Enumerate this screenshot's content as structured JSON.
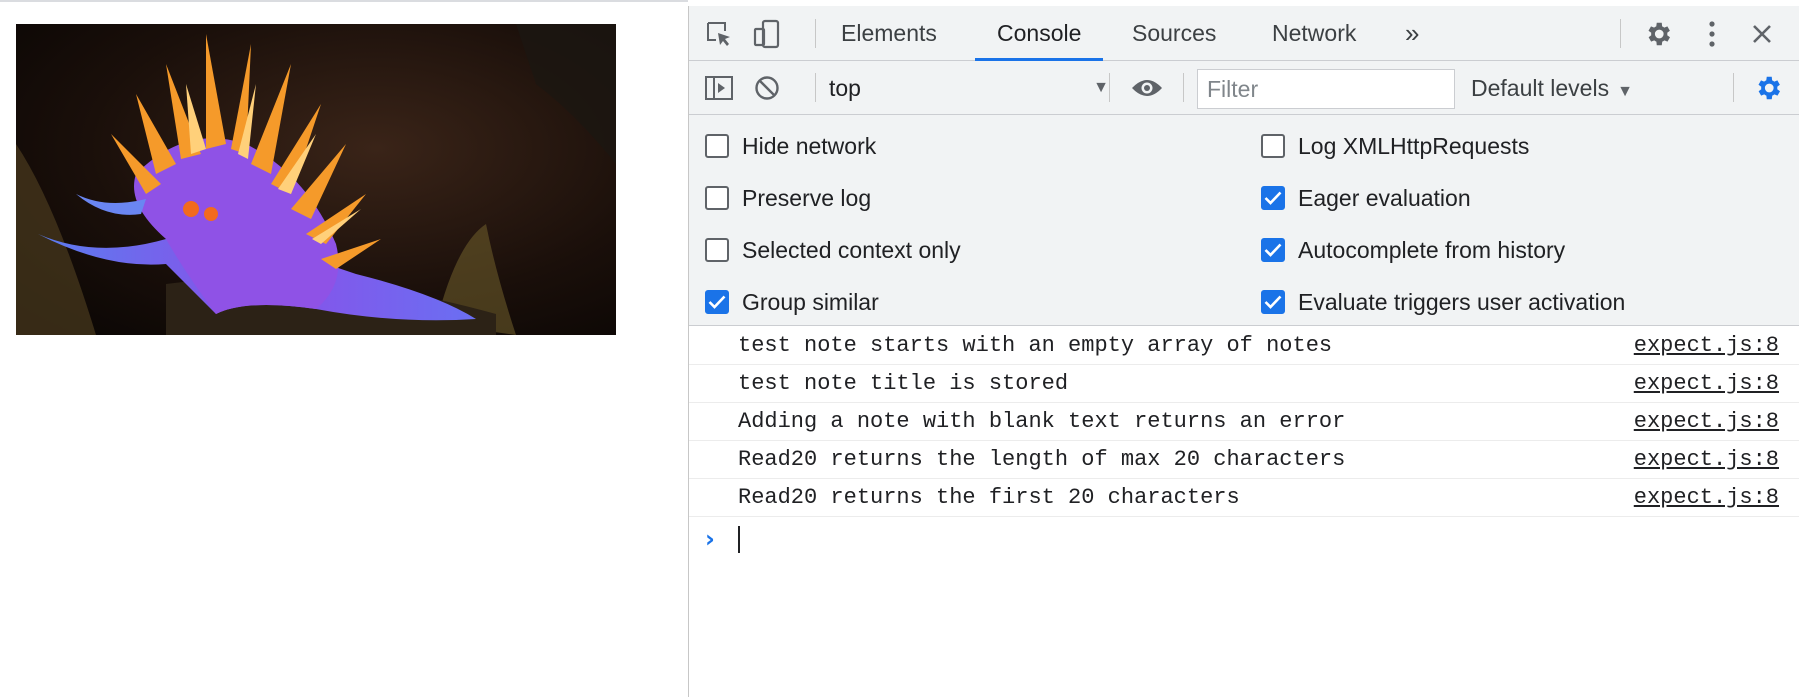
{
  "devtools": {
    "tabs": {
      "elements": "Elements",
      "console": "Console",
      "sources": "Sources",
      "network": "Network",
      "more": "»"
    },
    "toolbar": {
      "context": "top",
      "filter_placeholder": "Filter",
      "levels": "Default levels"
    },
    "settings": {
      "hide_network": "Hide network",
      "preserve_log": "Preserve log",
      "selected_context": "Selected context only",
      "group_similar": "Group similar",
      "log_xhr": "Log XMLHttpRequests",
      "eager_eval": "Eager evaluation",
      "autocomplete": "Autocomplete from history",
      "eval_triggers": "Evaluate triggers user activation"
    },
    "messages": [
      {
        "text": "test note starts with an empty array of notes",
        "source": "expect.js:8"
      },
      {
        "text": "test note title is stored",
        "source": "expect.js:8"
      },
      {
        "text": "Adding a note with blank text returns an error",
        "source": "expect.js:8"
      },
      {
        "text": "Read20 returns the length of max 20 characters",
        "source": "expect.js:8"
      },
      {
        "text": "Read20 returns the first 20 characters",
        "source": "expect.js:8"
      }
    ],
    "prompt_symbol": "›"
  },
  "colors": {
    "accent": "#1a73e8",
    "toolbar_bg": "#f1f3f4"
  }
}
